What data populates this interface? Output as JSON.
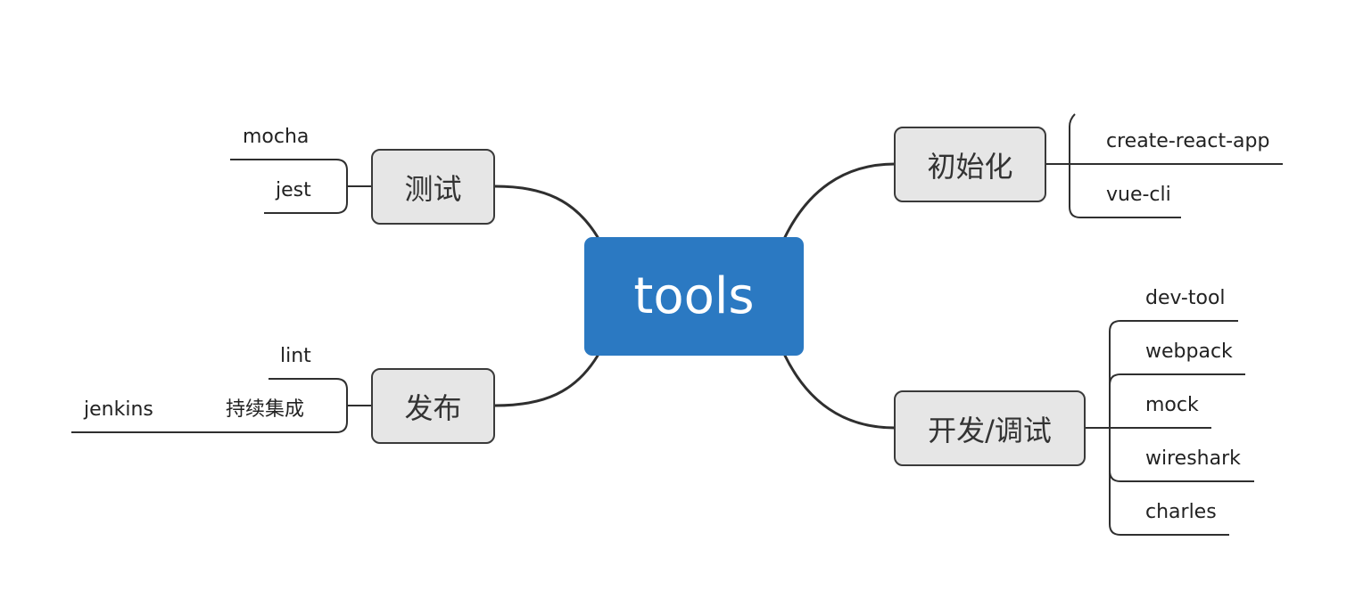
{
  "central": {
    "label": "tools",
    "color": "#2b79c2"
  },
  "line_color": "#2f2f2f",
  "topic_fill": "#e6e6e6",
  "branches": {
    "init": {
      "label": "初始化",
      "items": [
        "create-react-app",
        "vue-cli"
      ]
    },
    "dev": {
      "label": "开发/调试",
      "items": [
        "dev-tool",
        "webpack",
        "mock",
        "wireshark",
        "charles"
      ]
    },
    "test": {
      "label": "测试",
      "items": [
        "mocha",
        "jest"
      ]
    },
    "release": {
      "label": "发布",
      "items": [
        "lint",
        "持续集成"
      ],
      "sub": {
        "parent": "持续集成",
        "items": [
          "jenkins"
        ]
      }
    }
  }
}
